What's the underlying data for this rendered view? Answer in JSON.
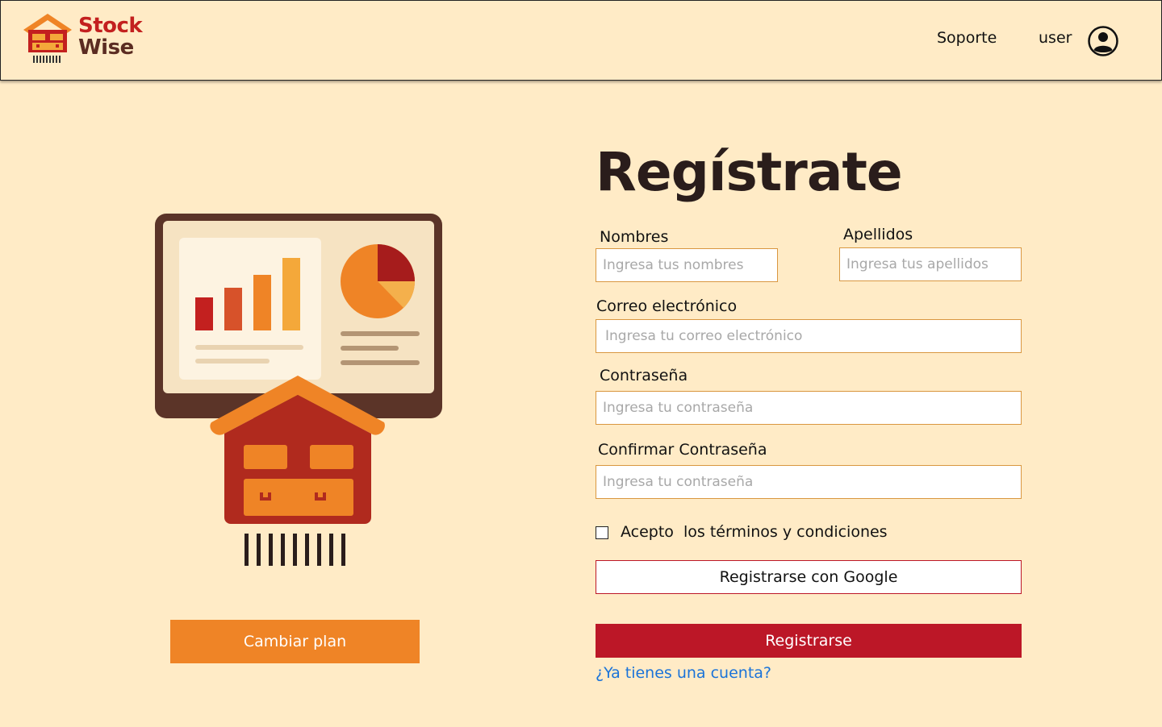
{
  "header": {
    "brand_line1": "Stock",
    "brand_line2": "Wise",
    "nav_support": "Soporte",
    "nav_user": "user",
    "icons": {
      "logo": "warehouse-logo-icon",
      "user": "user-circle-icon"
    }
  },
  "sidebar": {
    "illustration": "dashboard-warehouse-illustration",
    "change_plan_label": "Cambiar plan"
  },
  "form": {
    "title": "Regístrate",
    "first_name": {
      "label": "Nombres",
      "placeholder": "Ingresa tus nombres",
      "value": ""
    },
    "last_name": {
      "label": "Apellidos",
      "placeholder": "Ingresa tus apellidos",
      "value": ""
    },
    "email": {
      "label": "Correo electrónico",
      "placeholder": "Ingresa tu correo electrónico",
      "value": ""
    },
    "password": {
      "label": "Contraseña",
      "placeholder": "Ingresa tu contraseña",
      "value": ""
    },
    "confirm_password": {
      "label": "Confirmar Contraseña",
      "placeholder": "Ingresa tu contraseña",
      "value": ""
    },
    "terms_label": "Acepto  los términos y condiciones",
    "terms_checked": false,
    "google_button": "Registrarse con Google",
    "register_button": "Registrarse",
    "login_link": "¿Ya tienes una cuenta?"
  },
  "colors": {
    "background": "#FFEBC6",
    "accent_red": "#BC1727",
    "accent_orange": "#EF8426",
    "link_blue": "#1A73D9",
    "input_border": "#D99740"
  }
}
